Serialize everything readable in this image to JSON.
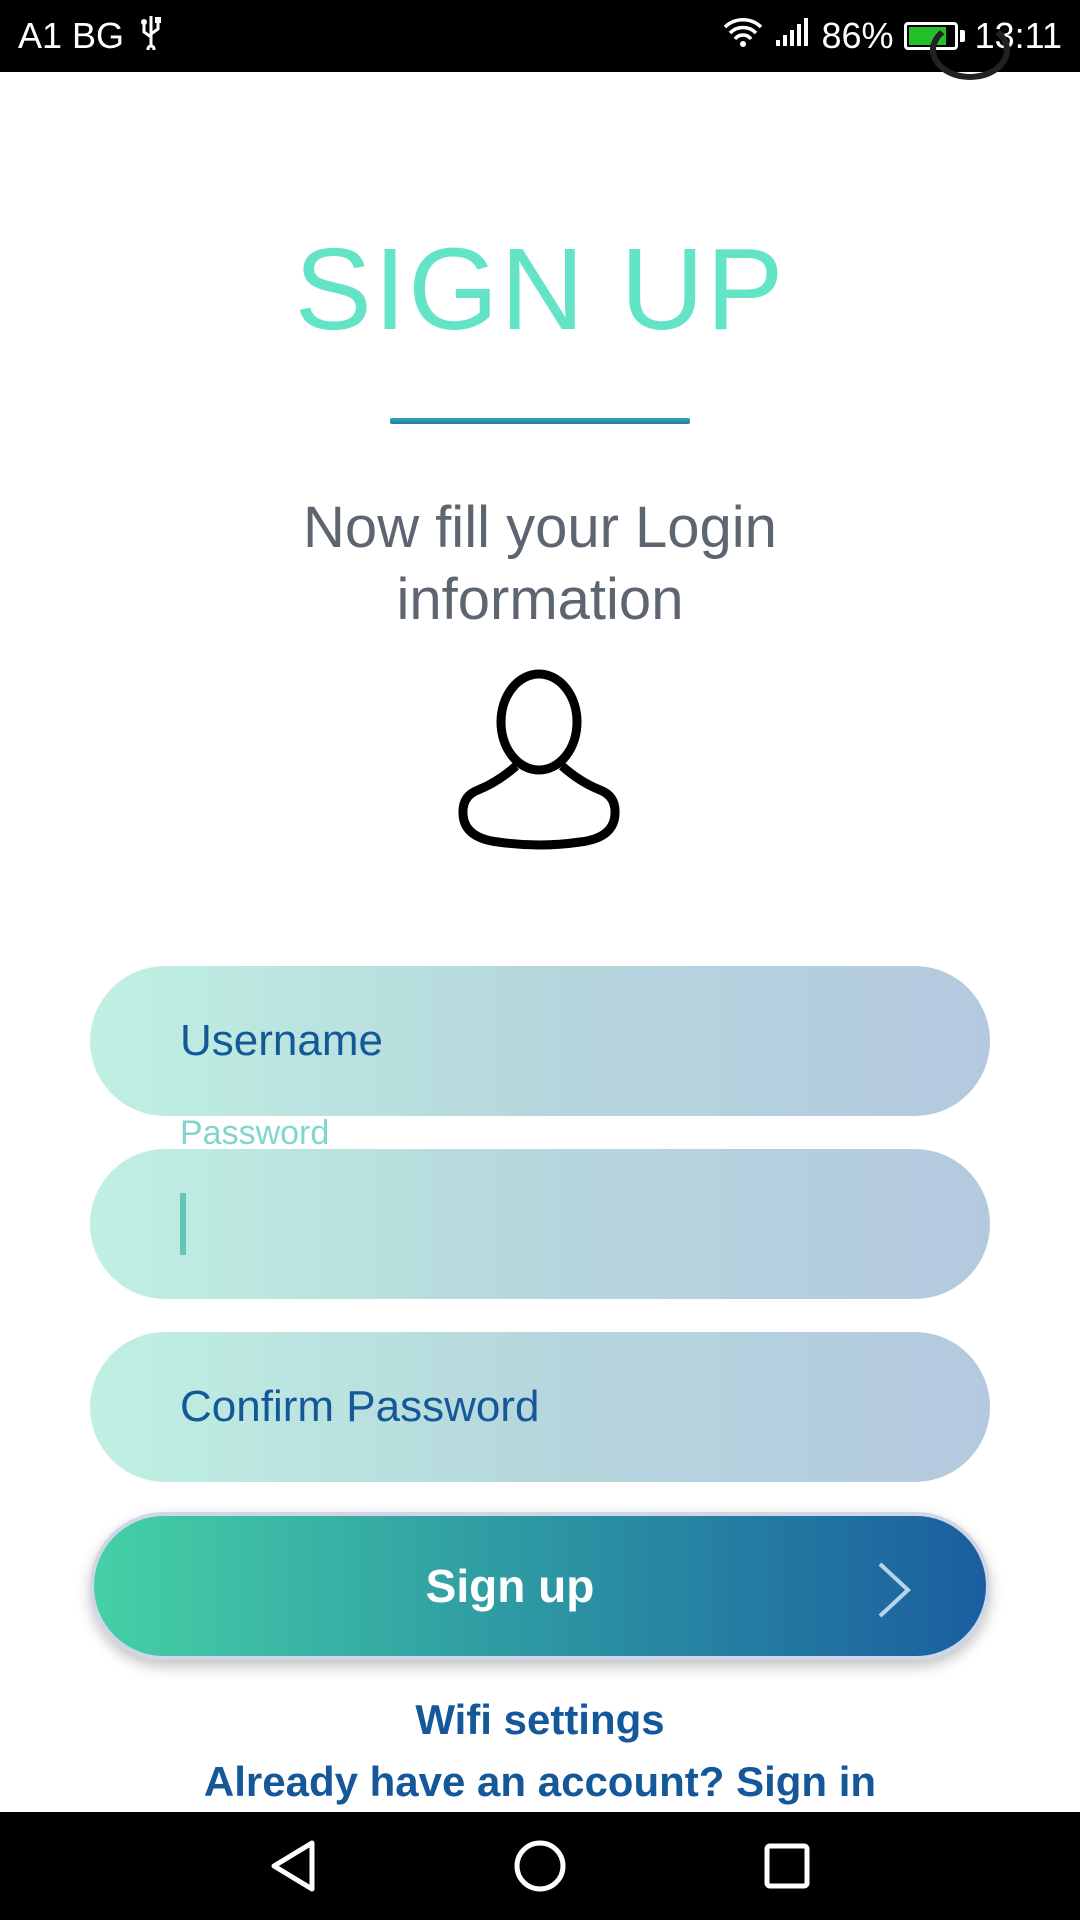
{
  "status_bar": {
    "carrier": "A1 BG",
    "usb_icon": "usb-icon",
    "wifi_icon": "wifi-icon",
    "signal_icon": "signal-icon",
    "battery_percent": "86%",
    "battery_level": 0.86,
    "time": "13:11"
  },
  "header": {
    "title": "SIGN UP",
    "subtitle": "Now fill your Login information"
  },
  "form": {
    "username_placeholder": "Username",
    "password_label": "Password",
    "password_value": "",
    "confirm_placeholder": "Confirm Password",
    "submit_label": "Sign up"
  },
  "links": {
    "wifi": "Wifi settings",
    "signin": "Already have an account? Sign in"
  },
  "colors": {
    "title": "#63e4c6",
    "accent_blue": "#14589a",
    "button_start": "#45d0a5",
    "button_end": "#1a5ea0"
  },
  "nav": {
    "back_icon": "back-triangle-icon",
    "home_icon": "home-circle-icon",
    "recents_icon": "recents-square-icon"
  }
}
